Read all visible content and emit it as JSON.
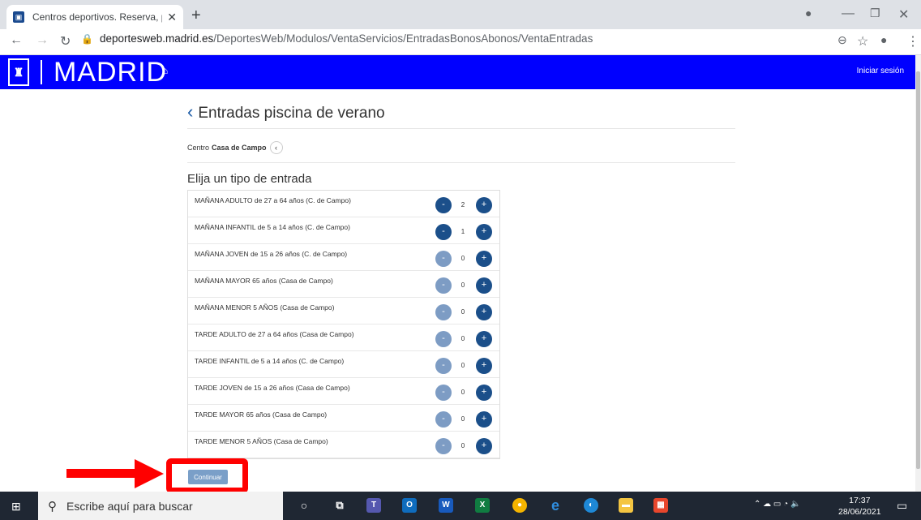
{
  "browser": {
    "tab_title": "Centros deportivos. Reserva, pag",
    "tab_close": "✕",
    "new_tab": "+",
    "url_host": "deportesweb.madrid.es",
    "url_path": "/DeportesWeb/Modulos/VentaServicios/EntradasBonosAbonos/VentaEntradas"
  },
  "header": {
    "title": "MADRID",
    "login_label": "Iniciar sesión",
    "accent_color": "#0000ff"
  },
  "page": {
    "title": "Entradas piscina de verano",
    "centro_label": "Centro",
    "centro_value": "Casa de Campo",
    "subtitle": "Elija un tipo de entrada",
    "continue_label": "Continuar"
  },
  "tickets": [
    {
      "label": "MAÑANA ADULTO de 27 a 64 años (C. de Campo)",
      "qty": "2",
      "active": true
    },
    {
      "label": "MAÑANA INFANTIL de 5 a 14 años (C. de Campo)",
      "qty": "1",
      "active": true
    },
    {
      "label": "MAÑANA JOVEN de 15 a 26 años (C. de Campo)",
      "qty": "0",
      "active": false
    },
    {
      "label": "MAÑANA MAYOR 65 años (Casa de Campo)",
      "qty": "0",
      "active": false
    },
    {
      "label": "MAÑANA MENOR 5 AÑOS (Casa de Campo)",
      "qty": "0",
      "active": false
    },
    {
      "label": "TARDE ADULTO de 27 a 64 años (Casa de Campo)",
      "qty": "0",
      "active": false
    },
    {
      "label": "TARDE INFANTIL de 5 a 14 años (C. de Campo)",
      "qty": "0",
      "active": false
    },
    {
      "label": "TARDE JOVEN de 15 a 26 años (Casa de Campo)",
      "qty": "0",
      "active": false
    },
    {
      "label": "TARDE MAYOR 65 años (Casa de Campo)",
      "qty": "0",
      "active": false
    },
    {
      "label": "TARDE MENOR 5 AÑOS (Casa de Campo)",
      "qty": "0",
      "active": false
    }
  ],
  "controls": {
    "minus": "-",
    "plus": "+"
  },
  "taskbar": {
    "search_placeholder": "Escribe aquí para buscar",
    "time": "17:37",
    "date": "28/06/2021"
  },
  "colors": {
    "button_active": "#1b4f8a",
    "button_disabled": "#7d9cc4",
    "highlight": "#ff0000"
  }
}
